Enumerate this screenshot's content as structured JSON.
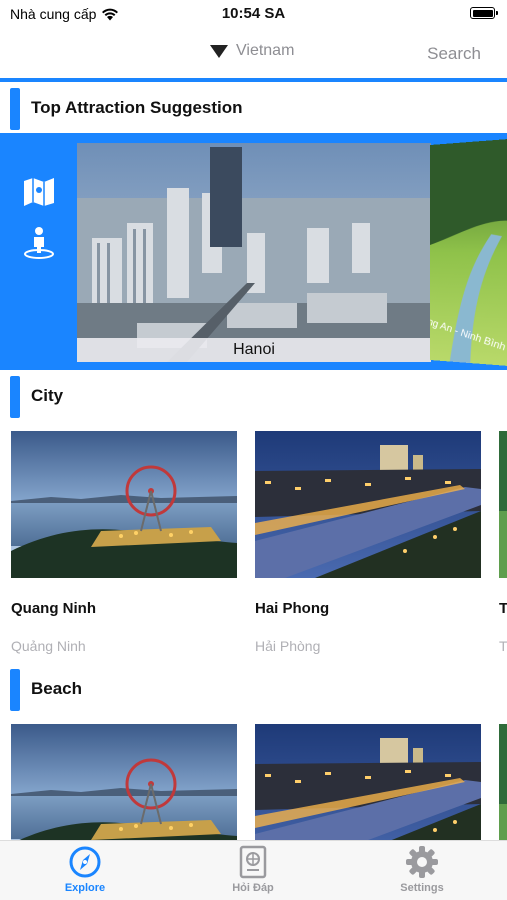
{
  "status_bar": {
    "carrier": "Nhà cung cấp",
    "time": "10:54 SA"
  },
  "nav": {
    "country": "Vietnam",
    "search_label": "Search"
  },
  "sections": {
    "top_attraction": {
      "title": "Top Attraction Suggestion",
      "main_caption": "Hanoi",
      "side_caption": "ng An - Ninh Bình"
    },
    "city": {
      "title": "City",
      "cards": [
        {
          "name": "Quang Ninh",
          "sub": "Quảng Ninh"
        },
        {
          "name": "Hai Phong",
          "sub": "Hải Phòng"
        },
        {
          "name": "T",
          "sub": "T"
        }
      ]
    },
    "beach": {
      "title": "Beach"
    }
  },
  "tabs": [
    {
      "label": "Explore",
      "icon": "compass-icon",
      "active": true
    },
    {
      "label": "Hỏi Đáp",
      "icon": "passport-icon",
      "active": false
    },
    {
      "label": "Settings",
      "icon": "gear-icon",
      "active": false
    }
  ],
  "colors": {
    "accent": "#1a85ff",
    "inactive": "#9a9a9e"
  }
}
